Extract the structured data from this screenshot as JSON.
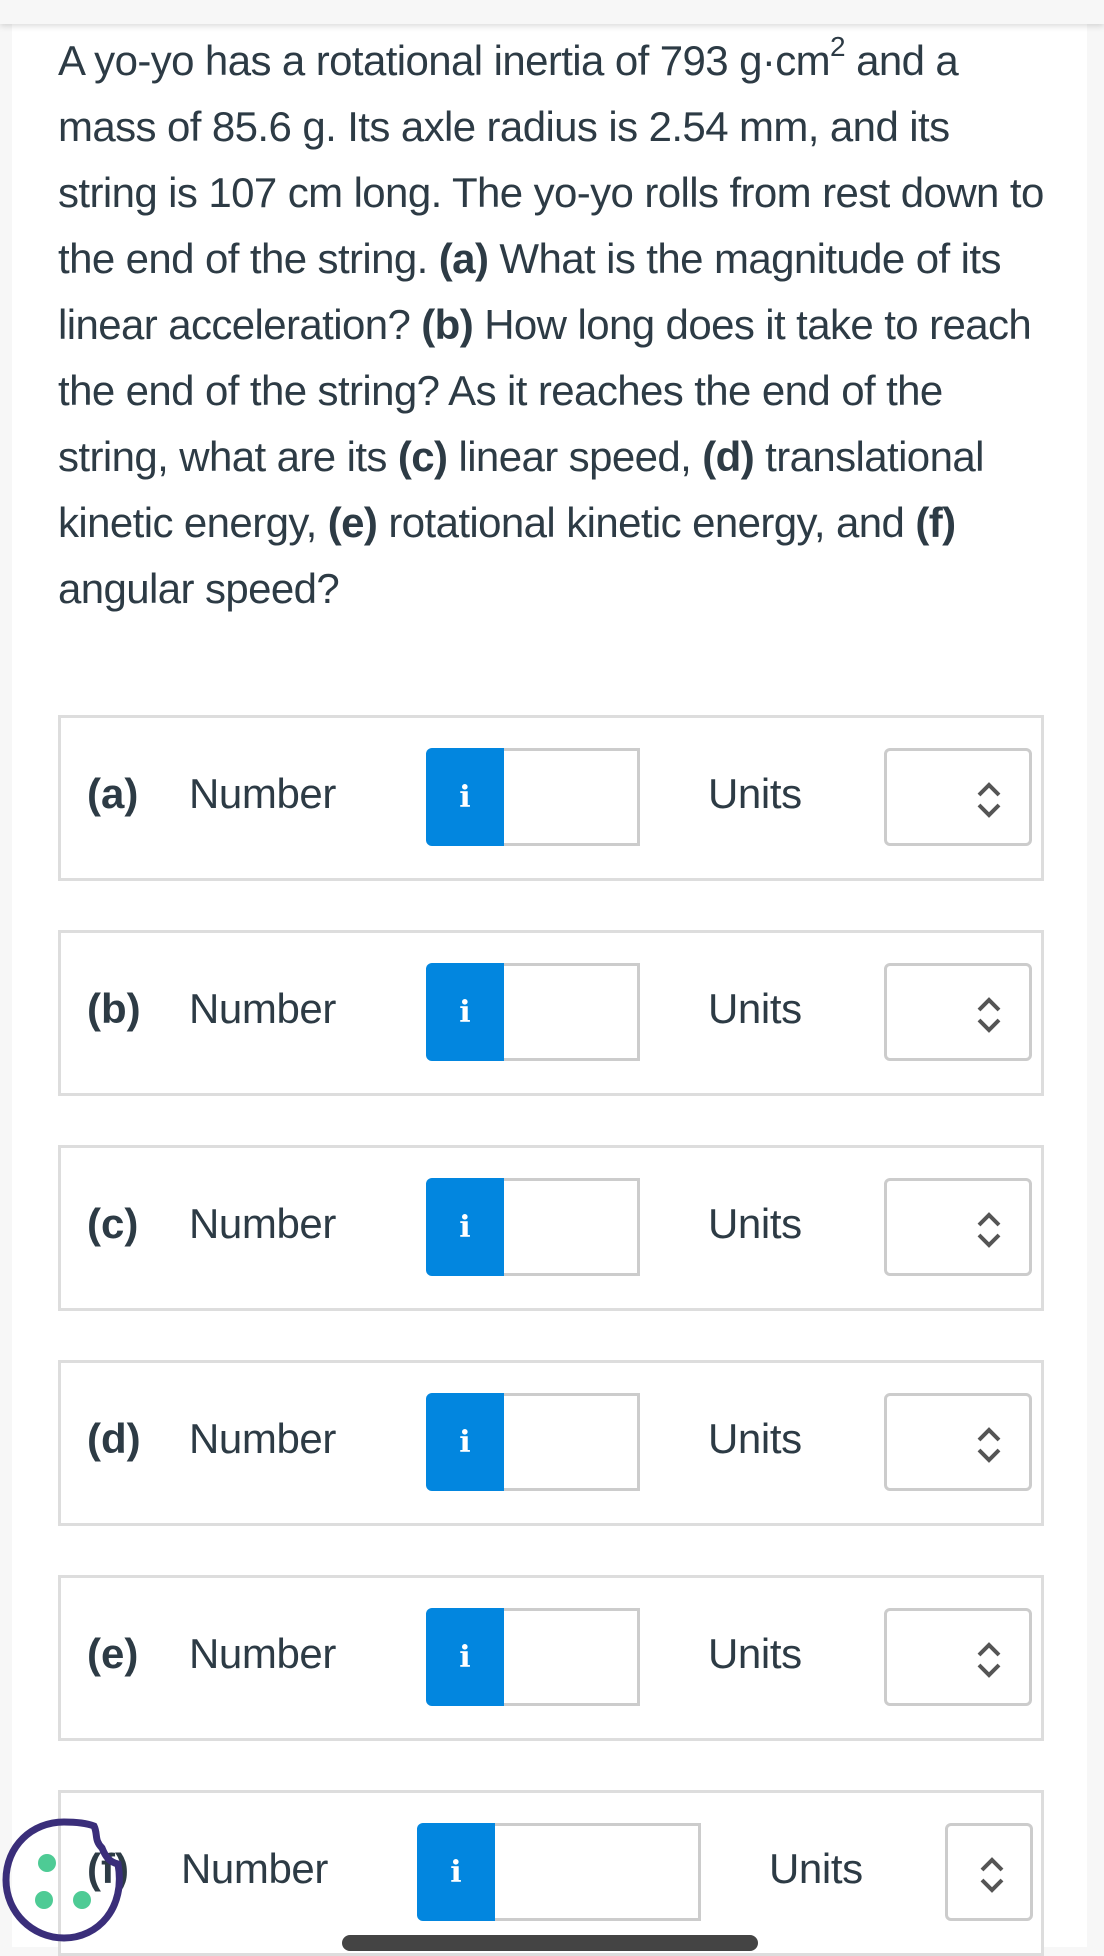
{
  "question": {
    "segments": [
      {
        "text": "A yo-yo has a rotational inertia of 793 g·cm",
        "bold": false
      },
      {
        "text": "2",
        "sup": true
      },
      {
        "text": " and a mass of 85.6 g. Its axle radius is 2.54 mm, and its string is 107 cm long. The yo-yo rolls from rest down to the end of the string. ",
        "bold": false
      },
      {
        "text": "(a)",
        "bold": true
      },
      {
        "text": " What is the magnitude of its linear acceleration? ",
        "bold": false
      },
      {
        "text": "(b)",
        "bold": true
      },
      {
        "text": " How long does it take to reach the end of the string? As it reaches the end of the string, what are its ",
        "bold": false
      },
      {
        "text": "(c)",
        "bold": true
      },
      {
        "text": " linear speed, ",
        "bold": false
      },
      {
        "text": "(d)",
        "bold": true
      },
      {
        "text": " translational kinetic energy, ",
        "bold": false
      },
      {
        "text": "(e)",
        "bold": true
      },
      {
        "text": " rotational kinetic energy, and ",
        "bold": false
      },
      {
        "text": "(f)",
        "bold": true
      },
      {
        "text": " angular speed?",
        "bold": false
      }
    ]
  },
  "answers": [
    {
      "part": "(a)",
      "number_label": "Number",
      "info_icon": "i",
      "value": "",
      "units_label": "Units",
      "units_selected": ""
    },
    {
      "part": "(b)",
      "number_label": "Number",
      "info_icon": "i",
      "value": "",
      "units_label": "Units",
      "units_selected": ""
    },
    {
      "part": "(c)",
      "number_label": "Number",
      "info_icon": "i",
      "value": "",
      "units_label": "Units",
      "units_selected": ""
    },
    {
      "part": "(d)",
      "number_label": "Number",
      "info_icon": "i",
      "value": "",
      "units_label": "Units",
      "units_selected": ""
    },
    {
      "part": "(e)",
      "number_label": "Number",
      "info_icon": "i",
      "value": "",
      "units_label": "Units",
      "units_selected": ""
    },
    {
      "part": "(f)",
      "number_label": "Number",
      "info_icon": "i",
      "value": "",
      "units_label": "Units",
      "units_selected": ""
    }
  ],
  "icons": {
    "info": "info-icon",
    "select_chevron": "chevron-up-down-icon",
    "cookie": "cookie-icon"
  },
  "colors": {
    "text": "#2d3b45",
    "info_button": "#0286df",
    "border": "#dddddd",
    "cookie_outline": "#3a2e7a",
    "cookie_dots": "#4ecb95"
  }
}
